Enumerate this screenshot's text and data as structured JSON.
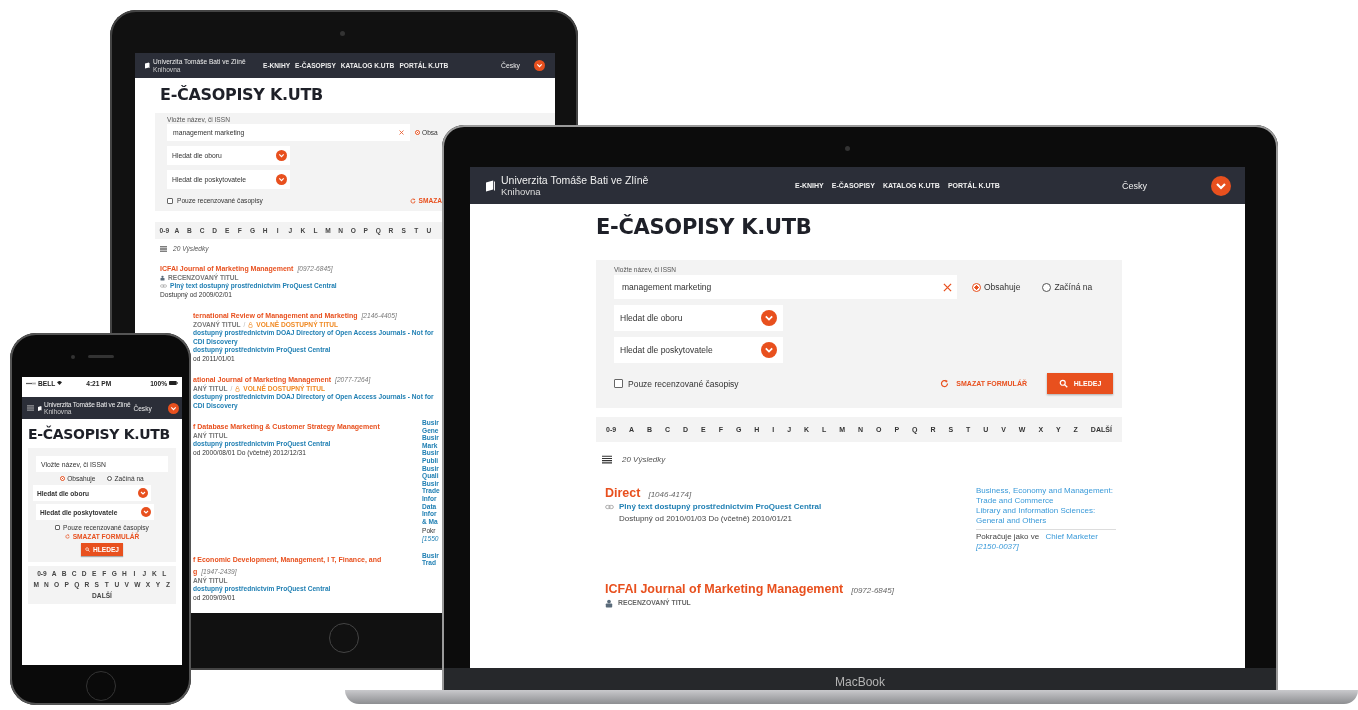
{
  "tablet": {
    "navbar": {
      "university": "Univerzita Tomáše Bati ve Zlíně",
      "library": "Knihovna",
      "links": [
        "E-KNIHY",
        "E-ČASOPISY",
        "KATALOG K.UTB",
        "PORTÁL K.UTB"
      ],
      "language": "Česky"
    },
    "title": "E-ČASOPISY K.UTB",
    "search": {
      "label": "Vložte název, či ISSN",
      "value": "management marketing",
      "match_options": [
        {
          "label": "Obsa",
          "selected": true
        }
      ],
      "selects": [
        "Hledat dle oboru",
        "Hledat dle poskytovatele"
      ],
      "reviewed_only": {
        "label": "Pouze recenzované časopisy",
        "checked": false
      },
      "clear": "SMAZA"
    },
    "alphabet": [
      "0-9",
      "A",
      "B",
      "C",
      "D",
      "E",
      "F",
      "G",
      "H",
      "I",
      "J",
      "K",
      "L",
      "M",
      "N",
      "O",
      "P",
      "Q",
      "R",
      "S",
      "T",
      "U"
    ],
    "results_count": "20 Výsledky",
    "results": [
      {
        "kind": "full",
        "title_lines": [
          "ICFAI Journal of Marketing Management"
        ],
        "issn": "[0972-6845]",
        "tags": [
          {
            "kind": "reviewed",
            "label": "RECENZOVANÝ TITUL"
          }
        ],
        "links": [
          "Plný text dostupný prostřednictvím ProQuest Central"
        ],
        "availability": "Dostupný od 2009/02/01"
      },
      {
        "kind": "cut",
        "title_lines": [
          "ternational Review of Management and Marketing"
        ],
        "issn": "[2146-4405]",
        "tags": [
          {
            "kind": "reviewed",
            "label": "ZOVANÝ TITUL"
          },
          {
            "kind": "open",
            "label": "VOLNĚ DOSTUPNÝ TITUL",
            "prefix": "/"
          }
        ],
        "links": [
          "dostupný prostřednictvím DOAJ Directory of Open Access Journals - Not for CDI Discovery",
          "dostupný prostřednictvím ProQuest Central"
        ],
        "availability": "od 2011/01/01"
      },
      {
        "kind": "cut",
        "title_lines": [
          "ational Journal of Marketing Management"
        ],
        "issn": "[2077-7264]",
        "tags": [
          {
            "kind": "reviewed",
            "label": "ANÝ TITUL"
          },
          {
            "kind": "open",
            "label": "VOLNĚ DOSTUPNÝ TITUL",
            "prefix": "/"
          }
        ],
        "links": [
          "dostupný prostřednictvím DOAJ Directory of Open Access Journals - Not for CDI Discovery"
        ]
      },
      {
        "kind": "cut",
        "title_lines": [
          "f Database Marketing & Customer Strategy Management"
        ],
        "tags": [
          {
            "kind": "reviewed",
            "label": "ANÝ TITUL"
          }
        ],
        "links": [
          "dostupný prostřednictvím ProQuest Central"
        ],
        "availability": "od 2000/08/01 Do (včetně) 2012/12/31",
        "subjects": [
          {
            "kind": "link",
            "text": "Busir"
          },
          {
            "kind": "link",
            "text": "Gene"
          },
          {
            "kind": "link",
            "text": "Busir"
          },
          {
            "kind": "link",
            "text": "Mark"
          },
          {
            "kind": "link",
            "text": "Busir"
          },
          {
            "kind": "link",
            "text": "Publi"
          },
          {
            "kind": "link",
            "text": "Busir"
          },
          {
            "kind": "link",
            "text": "Quali"
          },
          {
            "kind": "link",
            "text": "Busir"
          },
          {
            "kind": "link",
            "text": "Trade"
          },
          {
            "kind": "link",
            "text": "Infor"
          },
          {
            "kind": "link",
            "text": "Data"
          },
          {
            "kind": "link",
            "text": "Infor"
          },
          {
            "kind": "link",
            "text": "& Ma"
          },
          {
            "kind": "plain",
            "text": "Pokr"
          },
          {
            "kind": "issn",
            "text": "[1550"
          }
        ]
      },
      {
        "kind": "cut",
        "title_lines": [
          "f Economic Development, Management, I T, Finance, and",
          "g"
        ],
        "issn": "[1947-2439]",
        "tags": [
          {
            "kind": "reviewed",
            "label": "ANÝ TITUL"
          }
        ],
        "links": [
          "dostupný prostřednictvím ProQuest Central"
        ],
        "availability": "od 2009/09/01",
        "subjects": [
          {
            "kind": "link",
            "text": "Busir"
          },
          {
            "kind": "link",
            "text": "Trad"
          }
        ]
      }
    ]
  },
  "laptop": {
    "navbar": {
      "university": "Univerzita Tomáše Bati ve Zlíně",
      "library": "Knihovna",
      "links": [
        "E-KNIHY",
        "E-ČASOPISY",
        "KATALOG K.UTB",
        "PORTÁL K.UTB"
      ],
      "language": "Česky"
    },
    "title": "E-ČASOPISY K.UTB",
    "search": {
      "label": "Vložte název, či ISSN",
      "value": "management marketing",
      "match_options": [
        {
          "label": "Obsahuje",
          "selected": true
        },
        {
          "label": "Začíná na",
          "selected": false
        }
      ],
      "selects": [
        "Hledat dle oboru",
        "Hledat dle poskytovatele"
      ],
      "reviewed_only": {
        "label": "Pouze recenzované časopisy",
        "checked": false
      },
      "clear": "SMAZAT FORMULÁŘ",
      "submit": "HLEDEJ"
    },
    "alphabet": [
      "0-9",
      "A",
      "B",
      "C",
      "D",
      "E",
      "F",
      "G",
      "H",
      "I",
      "J",
      "K",
      "L",
      "M",
      "N",
      "O",
      "P",
      "Q",
      "R",
      "S",
      "T",
      "U",
      "V",
      "W",
      "X",
      "Y",
      "Z",
      "DALŠÍ"
    ],
    "results_count": "20 Výsledky",
    "results": [
      {
        "title": "Direct",
        "issn": "[1046-4174]",
        "links": [
          "Plný text dostupný prostřednictvím ProQuest Central"
        ],
        "availability": "Dostupný od 2010/01/03 Do (včetně) 2010/01/21",
        "subjects": [
          "Business, Economy and Management: Trade and Commerce",
          "Library and Information Sciences: General and Others"
        ],
        "continued": {
          "label": "Pokračuje jako ve",
          "title": "Chief Marketer",
          "issn": "[2150-0037]"
        }
      },
      {
        "title": "ICFAI Journal of Marketing Management",
        "issn": "[0972-6845]",
        "tags": [
          {
            "kind": "reviewed",
            "label": "RECENZOVANÝ TITUL"
          }
        ]
      }
    ],
    "brand": "MacBook"
  },
  "phone": {
    "status": {
      "carrier": "BELL",
      "time": "4:21 PM",
      "battery": "100%"
    },
    "navbar": {
      "university": "Univerzita Tomáše Bati ve Zlíně",
      "library": "Knihovna",
      "language": "Česky"
    },
    "title": "E-ČASOPISY K.UTB",
    "search": {
      "placeholder": "Vložte název, či ISSN",
      "match_options": [
        {
          "label": "Obsahuje",
          "selected": true
        },
        {
          "label": "Začíná na",
          "selected": false
        }
      ],
      "selects": [
        "Hledat dle oboru",
        "Hledat dle poskytovatele"
      ],
      "reviewed_only": {
        "label": "Pouze recenzované časopisy",
        "checked": false
      },
      "clear": "SMAZAT FORMULÁŘ",
      "submit": "HLEDEJ"
    },
    "alphabet": [
      "0-9",
      "A",
      "B",
      "C",
      "D",
      "E",
      "F",
      "G",
      "H",
      "I",
      "J",
      "K",
      "L",
      "M",
      "N",
      "O",
      "P",
      "Q",
      "R",
      "S",
      "T",
      "U",
      "V",
      "W",
      "X",
      "Y",
      "Z",
      "DALŠÍ"
    ]
  }
}
